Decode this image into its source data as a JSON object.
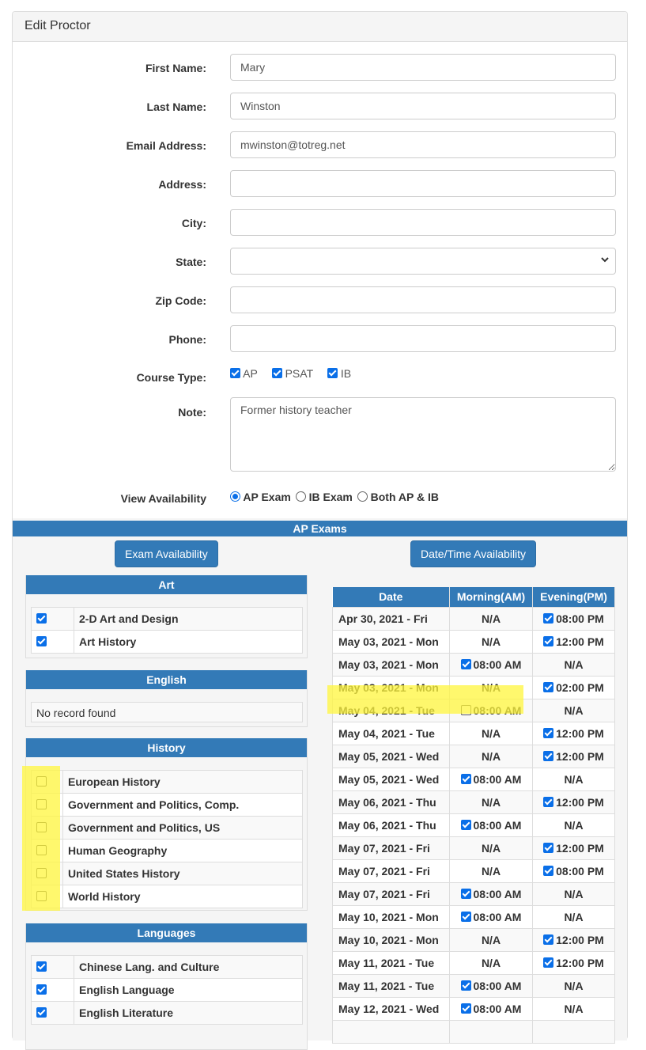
{
  "panel": {
    "title": "Edit Proctor"
  },
  "form": {
    "first_name": {
      "label": "First Name:",
      "value": "Mary"
    },
    "last_name": {
      "label": "Last Name:",
      "value": "Winston"
    },
    "email": {
      "label": "Email Address:",
      "value": "mwinston@totreg.net"
    },
    "address": {
      "label": "Address:",
      "value": ""
    },
    "city": {
      "label": "City:",
      "value": ""
    },
    "state": {
      "label": "State:",
      "value": ""
    },
    "zip": {
      "label": "Zip Code:",
      "value": ""
    },
    "phone": {
      "label": "Phone:",
      "value": ""
    },
    "course_type": {
      "label": "Course Type:",
      "options": [
        {
          "label": "AP",
          "checked": true
        },
        {
          "label": "PSAT",
          "checked": true
        },
        {
          "label": "IB",
          "checked": true
        }
      ]
    },
    "note": {
      "label": "Note:",
      "value": "Former history teacher"
    },
    "view_availability": {
      "label": "View Availability",
      "options": [
        {
          "label": "AP Exam",
          "selected": true
        },
        {
          "label": "IB Exam",
          "selected": false
        },
        {
          "label": "Both AP & IB",
          "selected": false
        }
      ]
    }
  },
  "ap_section": {
    "title": "AP Exams",
    "exam_availability_button": "Exam Availability",
    "datetime_availability_button": "Date/Time Availability",
    "categories": [
      {
        "name": "Art",
        "items": [
          {
            "label": "2-D Art and Design",
            "checked": true
          },
          {
            "label": "Art History",
            "checked": true
          }
        ]
      },
      {
        "name": "English",
        "empty_text": "No record found",
        "items": []
      },
      {
        "name": "History",
        "items": [
          {
            "label": "European History",
            "checked": false
          },
          {
            "label": "Government and Politics, Comp.",
            "checked": false
          },
          {
            "label": "Government and Politics, US",
            "checked": false
          },
          {
            "label": "Human Geography",
            "checked": false
          },
          {
            "label": "United States History",
            "checked": false
          },
          {
            "label": "World History",
            "checked": false
          }
        ]
      },
      {
        "name": "Languages",
        "items": [
          {
            "label": "Chinese Lang. and Culture",
            "checked": true
          },
          {
            "label": "English Language",
            "checked": true
          },
          {
            "label": "English Literature",
            "checked": true
          }
        ]
      }
    ],
    "schedule": {
      "headers": [
        "Date",
        "Morning(AM)",
        "Evening(PM)"
      ],
      "na_text": "N/A",
      "rows": [
        {
          "date": "Apr 30, 2021 - Fri",
          "am": null,
          "pm": {
            "time": "08:00 PM",
            "checked": true
          }
        },
        {
          "date": "May 03, 2021 - Mon",
          "am": null,
          "pm": {
            "time": "12:00 PM",
            "checked": true
          }
        },
        {
          "date": "May 03, 2021 - Mon",
          "am": {
            "time": "08:00 AM",
            "checked": true
          },
          "pm": null
        },
        {
          "date": "May 03, 2021 - Mon",
          "am": null,
          "pm": {
            "time": "02:00 PM",
            "checked": true
          }
        },
        {
          "date": "May 04, 2021 - Tue",
          "am": {
            "time": "08:00 AM",
            "checked": false
          },
          "pm": null
        },
        {
          "date": "May 04, 2021 - Tue",
          "am": null,
          "pm": {
            "time": "12:00 PM",
            "checked": true
          }
        },
        {
          "date": "May 05, 2021 - Wed",
          "am": null,
          "pm": {
            "time": "12:00 PM",
            "checked": true
          }
        },
        {
          "date": "May 05, 2021 - Wed",
          "am": {
            "time": "08:00 AM",
            "checked": true
          },
          "pm": null
        },
        {
          "date": "May 06, 2021 - Thu",
          "am": null,
          "pm": {
            "time": "12:00 PM",
            "checked": true
          }
        },
        {
          "date": "May 06, 2021 - Thu",
          "am": {
            "time": "08:00 AM",
            "checked": true
          },
          "pm": null
        },
        {
          "date": "May 07, 2021 - Fri",
          "am": null,
          "pm": {
            "time": "12:00 PM",
            "checked": true
          }
        },
        {
          "date": "May 07, 2021 - Fri",
          "am": null,
          "pm": {
            "time": "08:00 PM",
            "checked": true
          }
        },
        {
          "date": "May 07, 2021 - Fri",
          "am": {
            "time": "08:00 AM",
            "checked": true
          },
          "pm": null
        },
        {
          "date": "May 10, 2021 - Mon",
          "am": {
            "time": "08:00 AM",
            "checked": true
          },
          "pm": null
        },
        {
          "date": "May 10, 2021 - Mon",
          "am": null,
          "pm": {
            "time": "12:00 PM",
            "checked": true
          }
        },
        {
          "date": "May 11, 2021 - Tue",
          "am": null,
          "pm": {
            "time": "12:00 PM",
            "checked": true
          }
        },
        {
          "date": "May 11, 2021 - Tue",
          "am": {
            "time": "08:00 AM",
            "checked": true
          },
          "pm": null
        },
        {
          "date": "May 12, 2021 - Wed",
          "am": {
            "time": "08:00 AM",
            "checked": true
          },
          "pm": null
        },
        {
          "date": "",
          "am": null,
          "pm": null
        }
      ]
    }
  },
  "colors": {
    "primary": "#337ab7",
    "checkbox": "#0a6fe8",
    "highlight": "#fff53c"
  }
}
